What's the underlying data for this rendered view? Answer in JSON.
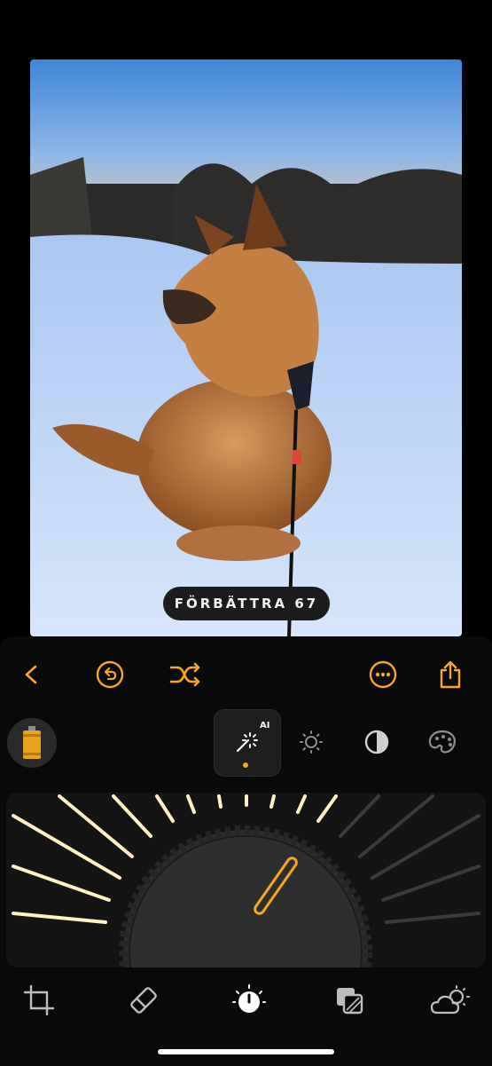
{
  "photo": {
    "subject": "dog-in-snow",
    "badge_label": "FÖRBÄTTRA 67"
  },
  "toolbar": {
    "back_icon": "chevron-left-icon",
    "undo_icon": "undo-icon",
    "shuffle_icon": "shuffle-icon",
    "more_icon": "ellipsis-circle-icon",
    "share_icon": "share-icon"
  },
  "modes": {
    "ai_badge": "AI",
    "items": [
      "magic-wand-ai-icon",
      "sun-icon",
      "contrast-icon",
      "palette-icon"
    ],
    "active_index": 0
  },
  "film_icon": "film-roll-icon",
  "dial": {
    "value": 67,
    "accent": "#f5a623"
  },
  "bottom_tabs": [
    "crop-icon",
    "eraser-icon",
    "adjust-dial-icon",
    "layers-icon",
    "weather-icon"
  ],
  "colors": {
    "accent": "#f5a623",
    "background": "#000000"
  }
}
